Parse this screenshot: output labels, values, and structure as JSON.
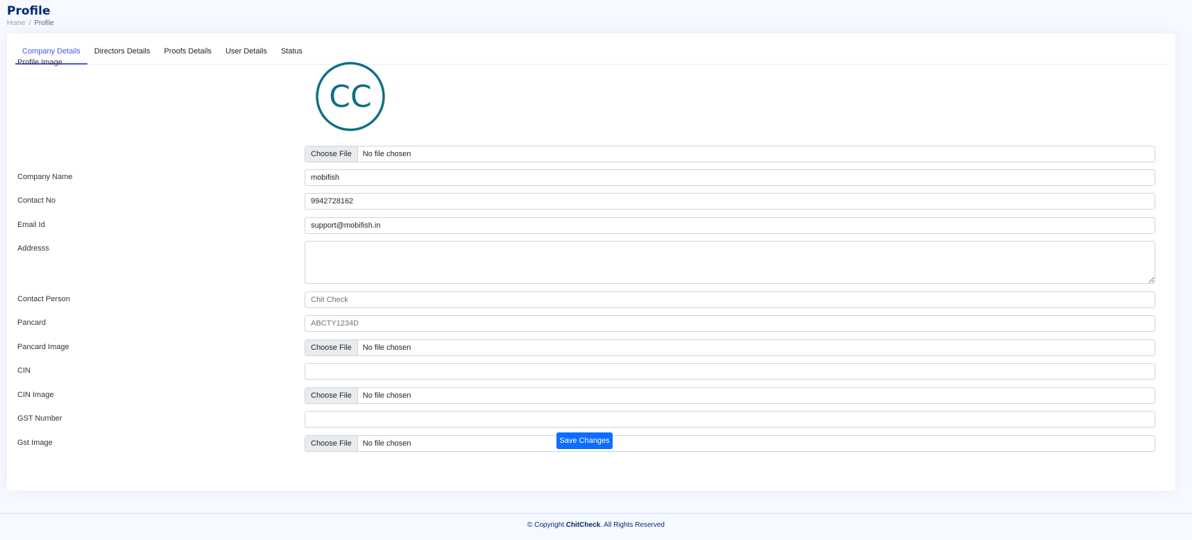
{
  "page": {
    "title": "Profile",
    "breadcrumb": [
      "Home",
      "Profile"
    ]
  },
  "tabs": [
    {
      "label": "Company Details",
      "active": true
    },
    {
      "label": "Directors Details",
      "active": false
    },
    {
      "label": "Proofs Details",
      "active": false
    },
    {
      "label": "User Details",
      "active": false
    },
    {
      "label": "Status",
      "active": false
    }
  ],
  "form": {
    "profile_image_label": "Profile Image",
    "logo_text": "CC",
    "logo_color": "#0e7083",
    "choose_file_label": "Choose File",
    "no_file_text": "No file chosen",
    "company_name": {
      "label": "Company Name",
      "value": "mobifish"
    },
    "contact_no": {
      "label": "Contact No",
      "value": "9942728162"
    },
    "email": {
      "label": "Email Id",
      "value": "support@mobifish.in"
    },
    "address": {
      "label": "Addresss",
      "value": ""
    },
    "contact_person": {
      "label": "Contact Person",
      "placeholder": "Chit Check"
    },
    "pancard": {
      "label": "Pancard",
      "placeholder": "ABCTY1234D"
    },
    "pancard_image": {
      "label": "Pancard Image"
    },
    "cin": {
      "label": "CIN",
      "value": ""
    },
    "cin_image": {
      "label": "CIN Image"
    },
    "gst_number": {
      "label": "GST Number",
      "value": ""
    },
    "gst_image": {
      "label": "Gst Image"
    },
    "save_label": "Save Changes"
  },
  "footer": {
    "prefix": "© Copyright ",
    "brand": "ChitCheck",
    "suffix": ". All Rights Reserved"
  },
  "colors": {
    "accent": "#4154f1",
    "primary_button": "#0d6efd",
    "title": "#012970"
  }
}
